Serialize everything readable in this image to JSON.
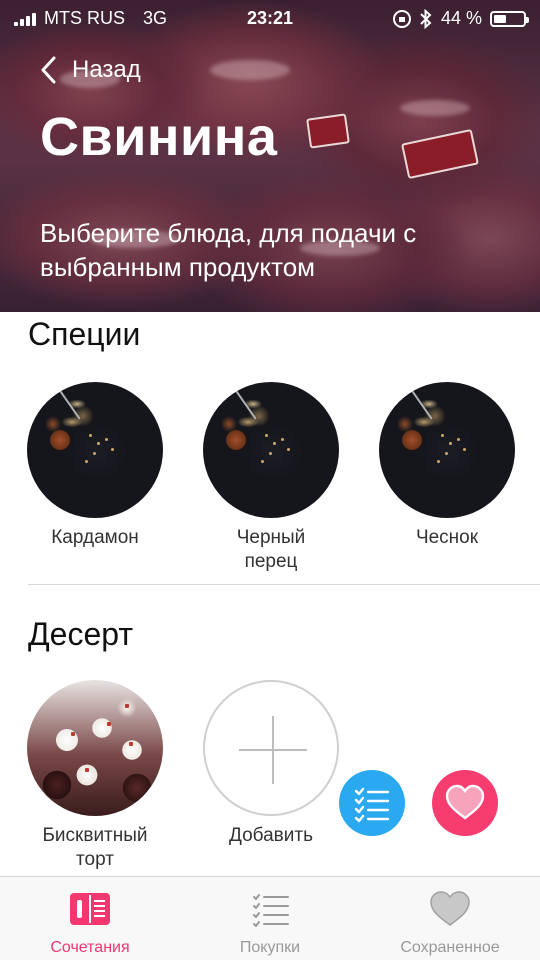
{
  "status_bar": {
    "carrier": "MTS RUS",
    "network": "3G",
    "time": "23:21",
    "battery_percent": "44 %",
    "battery_level": 0.44,
    "signal_bars": 4
  },
  "header": {
    "back_label": "Назад",
    "title": "Свинина",
    "subtitle": "Выберите блюда, для подачи с выбранным продуктом"
  },
  "sections": {
    "spices": {
      "title": "Специи",
      "items": [
        {
          "label": "Кардамон"
        },
        {
          "label": "Черный перец"
        },
        {
          "label": "Чеснок"
        }
      ]
    },
    "dessert": {
      "title": "Десерт",
      "items": [
        {
          "label": "Бисквитный торт"
        },
        {
          "label": "Добавить"
        }
      ]
    }
  },
  "tabbar": {
    "tabs": [
      {
        "label": "Сочетания",
        "icon": "book-icon",
        "active": true
      },
      {
        "label": "Покупки",
        "icon": "checklist-icon",
        "active": false
      },
      {
        "label": "Сохраненное",
        "icon": "heart-icon",
        "active": false
      }
    ]
  },
  "colors": {
    "accent": "#f33870",
    "fab_list": "#2aa8f0",
    "fab_heart": "#f73c70",
    "inactive_tab": "#999999"
  }
}
